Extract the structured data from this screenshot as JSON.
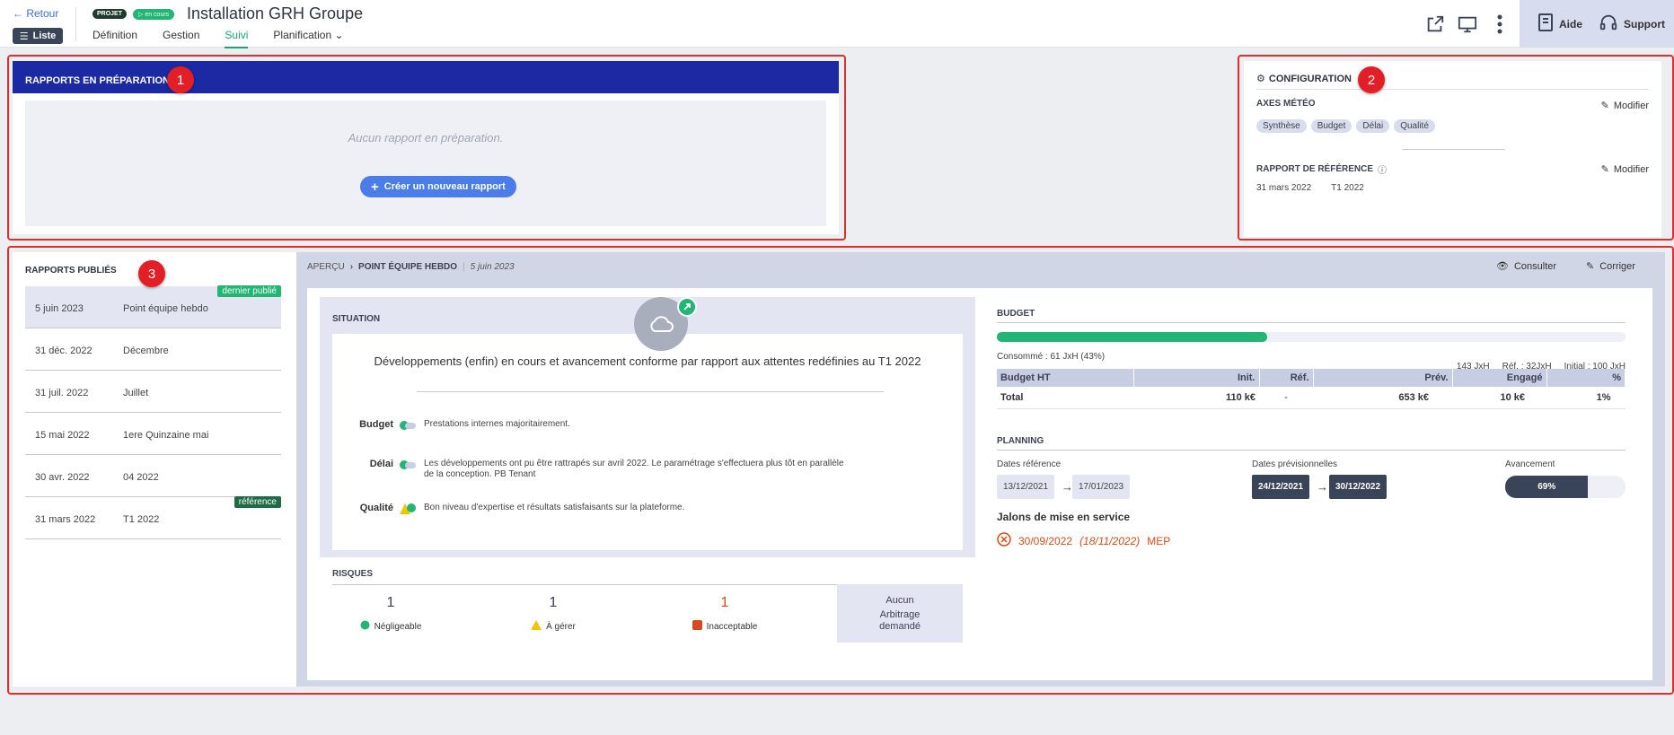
{
  "header": {
    "back": "← Retour",
    "list_label": "Liste",
    "badge_project": "PROJET",
    "badge_status": "▷ en cours",
    "title": "Installation GRH Groupe",
    "tabs": [
      {
        "label": "Définition"
      },
      {
        "label": "Gestion"
      },
      {
        "label": "Suivi"
      },
      {
        "label": "Planification"
      }
    ],
    "help": "Aide",
    "support": "Support"
  },
  "markers": {
    "m1": "1",
    "m2": "2",
    "m3": "3"
  },
  "reports_prep": {
    "title": "RAPPORTS EN PRÉPARATION",
    "empty": "Aucun rapport en préparation.",
    "create": "Créer un nouveau rapport"
  },
  "configuration": {
    "title": "CONFIGURATION",
    "axes_label": "AXES MÉTÉO",
    "modify": "Modifier",
    "axes": [
      "Synthèse",
      "Budget",
      "Délai",
      "Qualité"
    ],
    "ref_label": "RAPPORT DE RÉFÉRENCE",
    "ref_date": "31 mars 2022",
    "ref_name": "T1 2022"
  },
  "published": {
    "title": "RAPPORTS PUBLIÉS",
    "rows": [
      {
        "date": "5 juin 2023",
        "name": "Point équipe hebdo",
        "badge": "dernier publié"
      },
      {
        "date": "31 déc. 2022",
        "name": "Décembre",
        "badge": ""
      },
      {
        "date": "31 juil. 2022",
        "name": "Juillet",
        "badge": ""
      },
      {
        "date": "15 mai 2022",
        "name": "1ere Quinzaine mai",
        "badge": ""
      },
      {
        "date": "30 avr. 2022",
        "name": "04 2022",
        "badge": ""
      },
      {
        "date": "31 mars 2022",
        "name": "T1 2022",
        "badge": "référence"
      }
    ]
  },
  "preview": {
    "crumb1": "APERÇU",
    "crumb2": "POINT ÉQUIPE HEBDO",
    "crumb_date": "5 juin 2023",
    "consult": "Consulter",
    "correct": "Corriger"
  },
  "situation": {
    "title": "SITUATION",
    "text": "Développements (enfin) en cours et avancement conforme par rapport aux attentes redéfinies au T1 2022",
    "rows": [
      {
        "label": "Budget",
        "text": "Prestations internes majoritairement."
      },
      {
        "label": "Délai",
        "text": "Les développements ont pu être rattrapés sur avril 2022. Le paramétrage s'effectuera plus tôt en parallèle de la conception. PB Tenant"
      },
      {
        "label": "Qualité",
        "text": "Bon niveau d'expertise et résultats satisfaisants sur la plateforme."
      }
    ]
  },
  "risks": {
    "title": "RISQUES",
    "items": [
      {
        "count": "1",
        "label": "Négligeable"
      },
      {
        "count": "1",
        "label": "À gérer"
      },
      {
        "count": "1",
        "label": "Inacceptable"
      }
    ],
    "arb_1": "Aucun",
    "arb_2": "Arbitrage",
    "arb_3": "demandé"
  },
  "budget": {
    "title": "BUDGET",
    "progress_fraction": 0.43,
    "consumed": "Consommé : 61 JxH (43%)",
    "total_jxh": "143 JxH",
    "ref": "Réf. : 32JxH",
    "initial": "Initial : 100 JxH",
    "headers": [
      "Budget HT",
      "Init.",
      "Réf.",
      "Prév.",
      "Engagé",
      "%"
    ],
    "row": [
      "Total",
      "110 k€",
      "-",
      "653 k€",
      "10 k€",
      "1%"
    ]
  },
  "planning": {
    "title": "PLANNING",
    "ref_label": "Dates référence",
    "ref_start": "13/12/2021",
    "ref_end": "17/01/2023",
    "prev_label": "Dates prévisionnelles",
    "prev_start": "24/12/2021",
    "prev_end": "30/12/2022",
    "adv_label": "Avancement",
    "adv_value": "69%",
    "adv_fraction": 0.69,
    "milestones_title": "Jalons de mise en service",
    "ms_date": "30/09/2022",
    "ms_prev": "(18/11/2022)",
    "ms_name": "MEP"
  }
}
